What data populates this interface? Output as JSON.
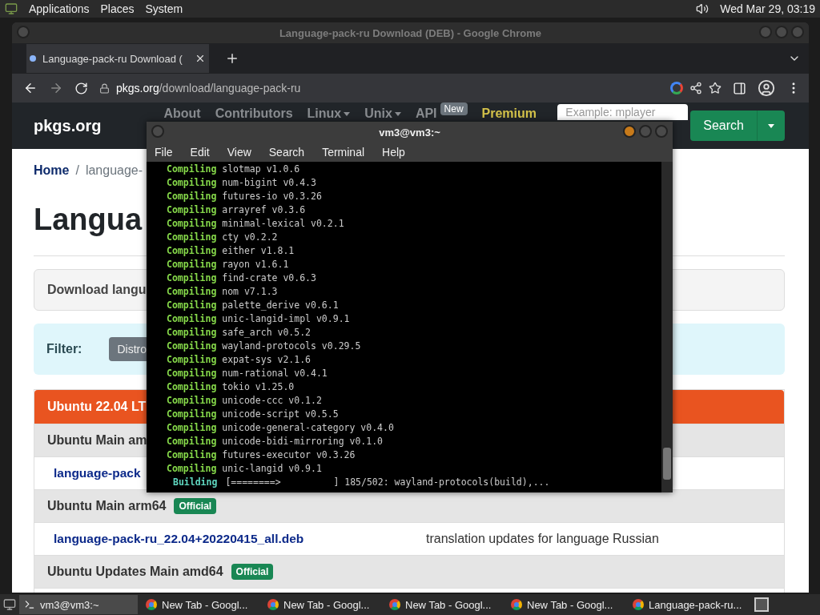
{
  "top_panel": {
    "menus": [
      "Applications",
      "Places",
      "System"
    ],
    "clock": "Wed Mar 29, 03:19"
  },
  "browser": {
    "title": "Language-pack-ru Download (DEB) - Google Chrome",
    "tab": {
      "label": "Language-pack-ru Download (",
      "selected": true
    },
    "url_host": "pkgs.org",
    "url_path": "/download/language-pack-ru"
  },
  "site": {
    "brand": "pkgs.org",
    "nav": [
      {
        "label": "About",
        "kind": "link"
      },
      {
        "label": "Contributors",
        "kind": "link"
      },
      {
        "label": "Linux",
        "kind": "menu"
      },
      {
        "label": "Unix",
        "kind": "menu"
      },
      {
        "label": "API",
        "kind": "link",
        "badge": "New"
      },
      {
        "label": "Premium",
        "kind": "premium"
      }
    ],
    "search_placeholder": "Example: mplayer",
    "search_button": "Search"
  },
  "breadcrumb": {
    "items": [
      "Home",
      "language-"
    ],
    "separator": "/"
  },
  "heading": "Langua",
  "download_note": "Download langu",
  "filter": {
    "label": "Filter:",
    "chip": "Distro"
  },
  "table": {
    "header": "Ubuntu 22.04 LT",
    "rows": [
      {
        "kind": "group",
        "text": "Ubuntu Main am"
      },
      {
        "kind": "file",
        "text": "language-pack"
      },
      {
        "kind": "group",
        "text": "Ubuntu Main arm64",
        "badge": "Official"
      },
      {
        "kind": "file",
        "text": "language-pack-ru_22.04+20220415_all.deb",
        "description": "translation updates for language Russian"
      },
      {
        "kind": "group",
        "text": "Ubuntu Updates Main amd64",
        "badge": "Official"
      },
      {
        "kind": "file"
      }
    ]
  },
  "terminal": {
    "title": "vm3@vm3:~",
    "menus": [
      "File",
      "Edit",
      "View",
      "Search",
      "Terminal",
      "Help"
    ],
    "lines": [
      {
        "verb": "Compiling",
        "text": "slotmap v1.0.6"
      },
      {
        "verb": "Compiling",
        "text": "num-bigint v0.4.3"
      },
      {
        "verb": "Compiling",
        "text": "futures-io v0.3.26"
      },
      {
        "verb": "Compiling",
        "text": "arrayref v0.3.6"
      },
      {
        "verb": "Compiling",
        "text": "minimal-lexical v0.2.1"
      },
      {
        "verb": "Compiling",
        "text": "cty v0.2.2"
      },
      {
        "verb": "Compiling",
        "text": "either v1.8.1"
      },
      {
        "verb": "Compiling",
        "text": "rayon v1.6.1"
      },
      {
        "verb": "Compiling",
        "text": "find-crate v0.6.3"
      },
      {
        "verb": "Compiling",
        "text": "nom v7.1.3"
      },
      {
        "verb": "Compiling",
        "text": "palette_derive v0.6.1"
      },
      {
        "verb": "Compiling",
        "text": "unic-langid-impl v0.9.1"
      },
      {
        "verb": "Compiling",
        "text": "safe_arch v0.5.2"
      },
      {
        "verb": "Compiling",
        "text": "wayland-protocols v0.29.5"
      },
      {
        "verb": "Compiling",
        "text": "expat-sys v2.1.6"
      },
      {
        "verb": "Compiling",
        "text": "num-rational v0.4.1"
      },
      {
        "verb": "Compiling",
        "text": "tokio v1.25.0"
      },
      {
        "verb": "Compiling",
        "text": "unicode-ccc v0.1.2"
      },
      {
        "verb": "Compiling",
        "text": "unicode-script v0.5.5"
      },
      {
        "verb": "Compiling",
        "text": "unicode-general-category v0.4.0"
      },
      {
        "verb": "Compiling",
        "text": "unicode-bidi-mirroring v0.1.0"
      },
      {
        "verb": "Compiling",
        "text": "futures-executor v0.3.26"
      },
      {
        "verb": "Compiling",
        "text": "unic-langid v0.9.1"
      }
    ],
    "status": {
      "verb": "Building",
      "bar": "[========>",
      "progress": "] 185/502: wayland-protocols(build),..."
    }
  },
  "taskbar": [
    {
      "label": "vm3@vm3:~",
      "kind": "terminal",
      "selected": true
    },
    {
      "label": "New Tab - Googl...",
      "kind": "chrome",
      "selected": false
    },
    {
      "label": "New Tab - Googl...",
      "kind": "chrome",
      "selected": false
    },
    {
      "label": "New Tab - Googl...",
      "kind": "chrome",
      "selected": false
    },
    {
      "label": "New Tab - Googl...",
      "kind": "chrome",
      "selected": false
    },
    {
      "label": "Language-pack-ru...",
      "kind": "chrome",
      "selected": false
    }
  ]
}
